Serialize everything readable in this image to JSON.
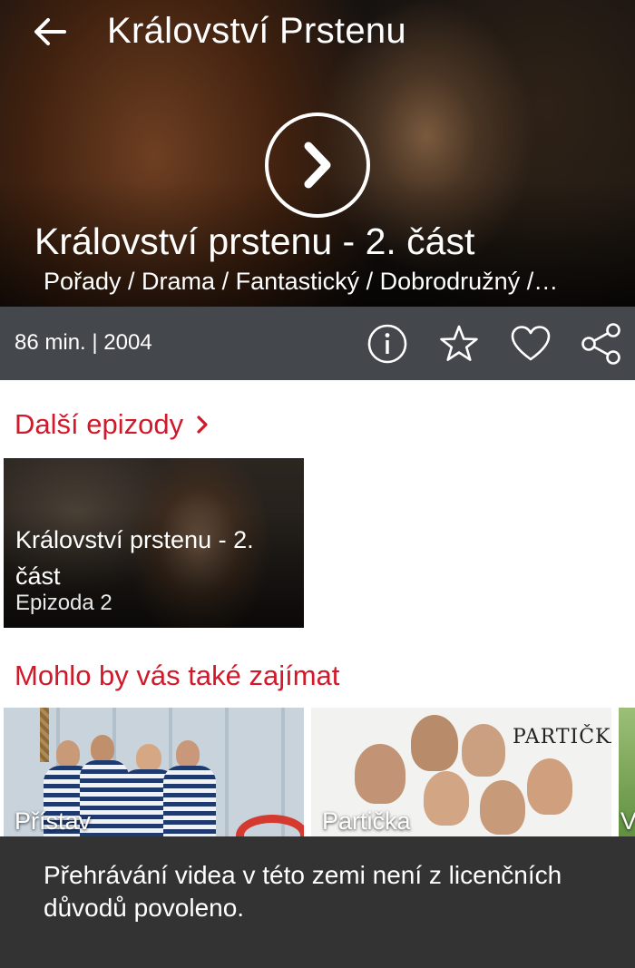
{
  "header": {
    "title": "Království Prstenu",
    "back_icon": "arrow-left-icon"
  },
  "hero": {
    "title": "Království prstenu - 2. část",
    "genres": "Pořady / Drama / Fantastický / Dobrodružný /…",
    "play_icon": "play-chevron-icon"
  },
  "info_bar": {
    "meta": "86 min. | 2004",
    "actions": [
      "info-icon",
      "star-icon",
      "heart-icon",
      "share-icon"
    ]
  },
  "episodes_section": {
    "title": "Další epizody",
    "card": {
      "title": "Království prstenu - 2. část",
      "subtitle": "Epizoda 2"
    }
  },
  "recommendations_section": {
    "title": "Mohlo by vás také zajímat",
    "items": [
      {
        "label": "Přístav"
      },
      {
        "label": "Partička",
        "logo_text": "PARTIČKA"
      },
      {
        "label": "V"
      }
    ]
  },
  "toast": {
    "message": "Přehrávání videa v této zemi není z licenčních důvodů povoleno."
  },
  "colors": {
    "accent_red": "#d0192b",
    "info_bar_bg": "#44474c",
    "toast_bg": "#333333"
  }
}
